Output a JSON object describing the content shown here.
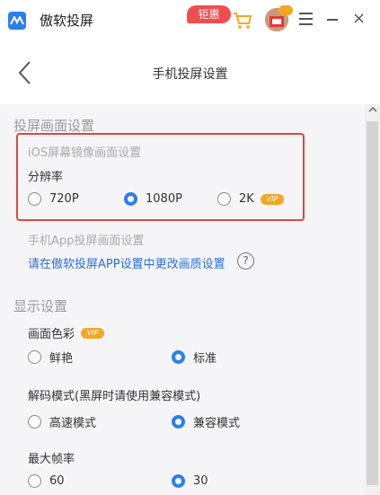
{
  "window": {
    "app_title": "傲软投屏",
    "promo_badge": "钜惠",
    "avatar_vip": "VIP",
    "close_glyph": "×"
  },
  "header": {
    "page_title": "手机投屏设置"
  },
  "screen_settings": {
    "title": "投屏画面设置",
    "ios_label": "iOS屏幕镜像画面设置",
    "resolution_label": "分辨率",
    "resolution_options": [
      {
        "label": "720P",
        "selected": false
      },
      {
        "label": "1080P",
        "selected": true
      },
      {
        "label": "2K",
        "selected": false,
        "vip": "VIP"
      }
    ],
    "app_label": "手机App投屏画面设置",
    "app_link": "请在傲软投屏APP设置中更改画质设置",
    "help_glyph": "?"
  },
  "display_settings": {
    "title": "显示设置",
    "color_label": "画面色彩",
    "color_vip": "VIP",
    "color_options": [
      {
        "label": "鲜艳",
        "selected": false
      },
      {
        "label": "标准",
        "selected": true
      }
    ],
    "decode_label": "解码模式(黑屏时请使用兼容模式)",
    "decode_options": [
      {
        "label": "高速模式",
        "selected": false
      },
      {
        "label": "兼容模式",
        "selected": true
      }
    ],
    "fps_label": "最大帧率",
    "fps_options": [
      {
        "label": "60",
        "selected": false
      },
      {
        "label": "30",
        "selected": true
      }
    ]
  },
  "colors": {
    "accent": "#2a7ef0",
    "highlight_border": "#e0463b",
    "vip": "#f5a623",
    "link": "#2a6ee0"
  },
  "icons": [
    "app-logo-icon",
    "cart-icon",
    "menu-icon",
    "minimize-icon",
    "close-icon",
    "back-icon",
    "help-icon",
    "scroll-up-icon"
  ]
}
